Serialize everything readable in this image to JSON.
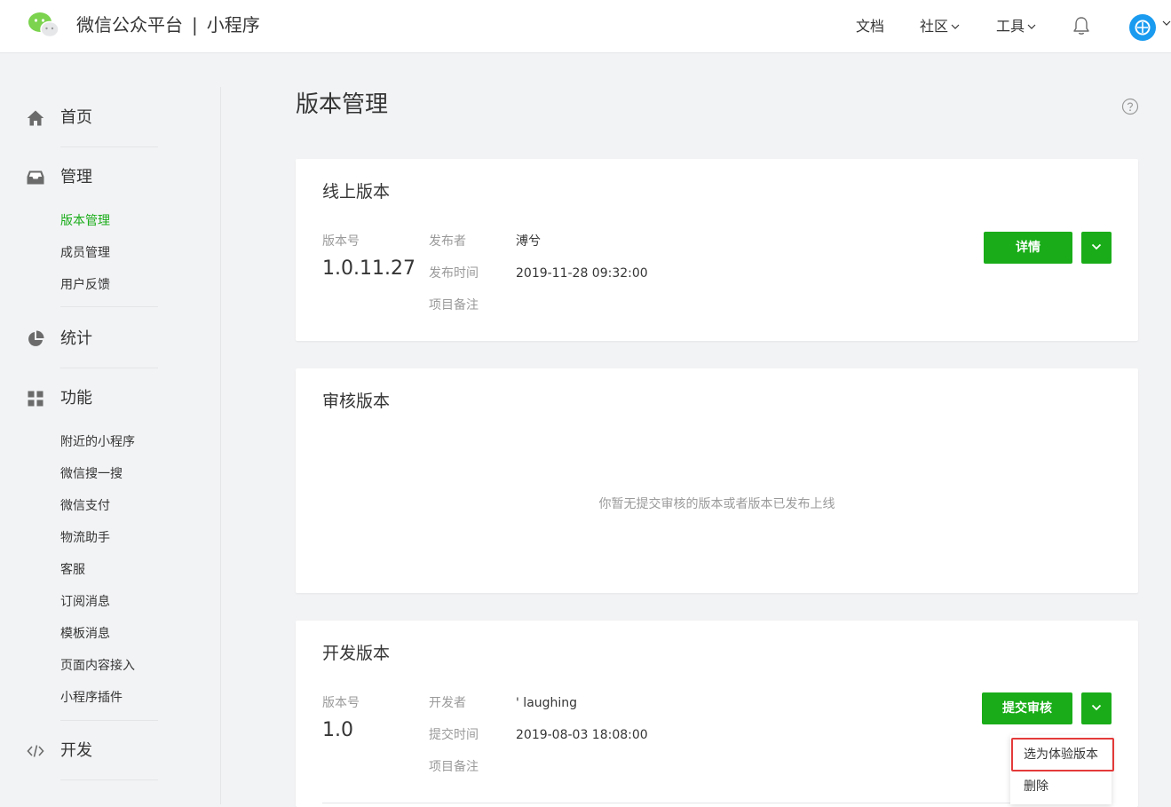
{
  "header": {
    "brand_name": "微信公众平台",
    "brand_sep": "|",
    "brand_sub": "小程序",
    "nav": [
      {
        "label": "文档"
      },
      {
        "label": "社区"
      },
      {
        "label": "工具"
      }
    ]
  },
  "sidebar": {
    "home": "首页",
    "manage": "管理",
    "manage_items": [
      "版本管理",
      "成员管理",
      "用户反馈"
    ],
    "stats": "统计",
    "features": "功能",
    "feature_items": [
      "附近的小程序",
      "微信搜一搜",
      "微信支付",
      "物流助手",
      "客服",
      "订阅消息",
      "模板消息",
      "页面内容接入",
      "小程序插件"
    ],
    "develop": "开发"
  },
  "main": {
    "page_title": "版本管理",
    "online": {
      "title": "线上版本",
      "version_label": "版本号",
      "version": "1.0.11.27",
      "publisher_label": "发布者",
      "publisher": "溥兮",
      "publish_time_label": "发布时间",
      "publish_time": "2019-11-28 09:32:00",
      "note_label": "项目备注",
      "detail_button": "详情"
    },
    "review": {
      "title": "审核版本",
      "empty_text": "你暂无提交审核的版本或者版本已发布上线"
    },
    "dev": {
      "title": "开发版本",
      "version_label": "版本号",
      "version": "1.0",
      "developer_label": "开发者",
      "developer": "' laughing",
      "submit_time_label": "提交时间",
      "submit_time": "2019-08-03 18:08:00",
      "note_label": "项目备注",
      "submit_button": "提交审核",
      "dropdown": [
        "选为体验版本",
        "删除"
      ]
    }
  },
  "colors": {
    "accent_green": "#1aad19",
    "highlight_red": "#e43a3a",
    "avatar_blue": "#1a9bf0"
  }
}
